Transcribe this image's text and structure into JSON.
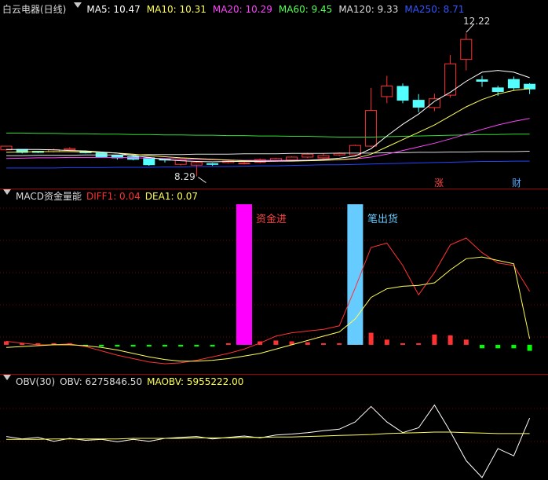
{
  "main": {
    "title": "白云电器(日线)",
    "indicators": [
      {
        "label": "MA5: 10.47",
        "color": "#ffffff"
      },
      {
        "label": "MA10: 10.31",
        "color": "#ffff55"
      },
      {
        "label": "MA20: 10.29",
        "color": "#ff44ff"
      },
      {
        "label": "MA60: 9.45",
        "color": "#55ff55"
      },
      {
        "label": "MA120: 9.33",
        "color": "#dddddd"
      },
      {
        "label": "MA250: 8.71",
        "color": "#3355ff"
      }
    ],
    "high_label": "12.22",
    "low_label": "8.29",
    "zhang_label": "涨",
    "cai_label": "财"
  },
  "macd": {
    "title": "MACD资金量能",
    "diff_label": "DIFF1: 0.04",
    "dea_label": "DEA1: 0.07",
    "in_label": "资金进",
    "out_label": "笔出货"
  },
  "obv": {
    "title": "OBV(30)",
    "obv_label": "OBV: 6275846.50",
    "maobv_label": "MAOBV: 5955222.00"
  },
  "colors": {
    "up": "#ff3232",
    "down": "#54ffff",
    "frame": "#a00000",
    "grid": "#7a0000",
    "in_bar": "#ff00ff",
    "out_bar": "#66ccff",
    "neg_hist": "#00ff00"
  },
  "chart_data": [
    {
      "type": "candlestick",
      "title": "白云电器(日线)",
      "x": [
        1,
        2,
        3,
        4,
        5,
        6,
        7,
        8,
        9,
        10,
        11,
        12,
        13,
        14,
        15,
        16,
        17,
        18,
        19,
        20,
        21,
        22,
        23,
        24,
        25,
        26,
        27,
        28,
        29,
        30,
        31,
        32,
        33,
        34
      ],
      "open": [
        9.02,
        9.03,
        8.98,
        8.97,
        9.02,
        8.98,
        8.93,
        8.87,
        8.83,
        8.8,
        8.76,
        8.62,
        8.6,
        8.64,
        8.67,
        8.66,
        8.68,
        8.72,
        8.74,
        8.82,
        8.8,
        8.88,
        8.88,
        9.12,
        10.48,
        10.76,
        10.38,
        10.18,
        10.52,
        11.5,
        10.94,
        10.72,
        10.95,
        10.82
      ],
      "close": [
        9.12,
        8.95,
        8.95,
        9.02,
        9.05,
        8.94,
        8.83,
        8.8,
        8.76,
        8.61,
        8.74,
        8.73,
        8.67,
        8.62,
        8.71,
        8.66,
        8.75,
        8.78,
        8.82,
        8.9,
        8.86,
        8.92,
        9.14,
        10.1,
        10.77,
        10.38,
        10.19,
        10.42,
        11.38,
        12.05,
        10.9,
        10.62,
        10.72,
        10.69
      ],
      "high": [
        9.12,
        9.04,
        8.98,
        9.05,
        9.09,
        9.0,
        8.94,
        8.88,
        8.85,
        8.82,
        8.77,
        8.75,
        8.7,
        8.66,
        8.73,
        8.7,
        8.78,
        8.8,
        8.84,
        8.94,
        8.92,
        8.95,
        9.16,
        10.72,
        11.05,
        10.84,
        10.55,
        10.56,
        11.62,
        12.22,
        11.05,
        10.78,
        11.03,
        10.85
      ],
      "low": [
        9.0,
        8.92,
        8.93,
        8.95,
        9.0,
        8.92,
        8.8,
        8.75,
        8.73,
        8.58,
        8.67,
        8.59,
        8.29,
        8.58,
        8.64,
        8.62,
        8.65,
        8.7,
        8.71,
        8.79,
        8.78,
        8.85,
        8.85,
        9.1,
        10.3,
        10.3,
        10.05,
        10.08,
        10.45,
        11.2,
        10.75,
        10.5,
        10.65,
        10.55
      ],
      "ma5": [
        9.03,
        9.03,
        9.03,
        9.02,
        9.0,
        8.99,
        8.96,
        8.93,
        8.86,
        8.81,
        8.75,
        8.72,
        8.7,
        8.69,
        8.7,
        8.7,
        8.7,
        8.71,
        8.72,
        8.73,
        8.76,
        8.79,
        8.85,
        9.05,
        9.4,
        9.72,
        10.0,
        10.35,
        10.6,
        10.9,
        11.15,
        11.2,
        11.15,
        11.0
      ],
      "ma10": [
        8.95,
        8.96,
        8.97,
        8.97,
        8.97,
        8.96,
        8.95,
        8.93,
        8.9,
        8.86,
        8.83,
        8.8,
        8.78,
        8.76,
        8.74,
        8.72,
        8.71,
        8.71,
        8.71,
        8.72,
        8.73,
        8.75,
        8.78,
        8.9,
        9.1,
        9.3,
        9.5,
        9.7,
        9.95,
        10.2,
        10.4,
        10.55,
        10.65,
        10.7
      ],
      "ma20": [
        8.78,
        8.79,
        8.8,
        8.8,
        8.81,
        8.81,
        8.81,
        8.81,
        8.8,
        8.79,
        8.78,
        8.77,
        8.76,
        8.75,
        8.74,
        8.73,
        8.73,
        8.73,
        8.73,
        8.74,
        8.74,
        8.75,
        8.77,
        8.82,
        8.9,
        9.0,
        9.1,
        9.2,
        9.32,
        9.45,
        9.58,
        9.7,
        9.8,
        9.88
      ],
      "ma60": [
        9.48,
        9.48,
        9.47,
        9.47,
        9.46,
        9.46,
        9.45,
        9.45,
        9.44,
        9.44,
        9.43,
        9.43,
        9.42,
        9.42,
        9.41,
        9.41,
        9.4,
        9.4,
        9.39,
        9.39,
        9.38,
        9.37,
        9.37,
        9.37,
        9.38,
        9.39,
        9.4,
        9.41,
        9.42,
        9.43,
        9.44,
        9.44,
        9.45,
        9.45
      ],
      "ma120": [
        8.86,
        8.86,
        8.87,
        8.87,
        8.87,
        8.88,
        8.88,
        8.88,
        8.88,
        8.89,
        8.89,
        8.89,
        8.9,
        8.9,
        8.9,
        8.91,
        8.91,
        8.91,
        8.92,
        8.92,
        8.92,
        8.93,
        8.93,
        8.93,
        8.94,
        8.94,
        8.95,
        8.95,
        8.96,
        8.96,
        8.97,
        8.97,
        8.97,
        8.98
      ],
      "ma250": [
        8.52,
        8.52,
        8.52,
        8.52,
        8.53,
        8.53,
        8.53,
        8.54,
        8.54,
        8.54,
        8.55,
        8.55,
        8.56,
        8.56,
        8.56,
        8.57,
        8.58,
        8.58,
        8.59,
        8.6,
        8.61,
        8.61,
        8.62,
        8.63,
        8.64,
        8.65,
        8.66,
        8.67,
        8.68,
        8.69,
        8.7,
        8.7,
        8.71,
        8.71
      ],
      "ylim": [
        8.0,
        12.7
      ]
    },
    {
      "type": "line",
      "title": "MACD资金量能",
      "x": [
        1,
        2,
        3,
        4,
        5,
        6,
        7,
        8,
        9,
        10,
        11,
        12,
        13,
        14,
        15,
        16,
        17,
        18,
        19,
        20,
        21,
        22,
        23,
        24,
        25,
        26,
        27,
        28,
        29,
        30,
        31,
        32,
        33,
        34
      ],
      "series": [
        {
          "name": "DIFF1",
          "values": [
            0.04,
            0.02,
            0.0,
            0.0,
            0.01,
            -0.02,
            -0.07,
            -0.12,
            -0.16,
            -0.2,
            -0.22,
            -0.21,
            -0.18,
            -0.14,
            -0.1,
            -0.05,
            0.02,
            0.1,
            0.14,
            0.16,
            0.18,
            0.22,
            0.66,
            1.13,
            1.18,
            0.92,
            0.58,
            0.84,
            1.16,
            1.24,
            1.07,
            0.95,
            0.92,
            0.62
          ]
        },
        {
          "name": "DEA1",
          "values": [
            -0.03,
            -0.02,
            -0.01,
            0.0,
            0.0,
            -0.01,
            -0.03,
            -0.06,
            -0.1,
            -0.14,
            -0.17,
            -0.19,
            -0.19,
            -0.18,
            -0.16,
            -0.13,
            -0.1,
            -0.05,
            0.0,
            0.05,
            0.1,
            0.15,
            0.3,
            0.55,
            0.65,
            0.68,
            0.69,
            0.72,
            0.87,
            1.0,
            1.02,
            0.98,
            0.94,
            0.07
          ]
        }
      ],
      "histogram": [
        0.04,
        0.02,
        0.0,
        0.0,
        0.01,
        -0.02,
        -0.02,
        -0.02,
        -0.02,
        -0.02,
        -0.02,
        -0.02,
        -0.02,
        -0.02,
        0.0,
        0.02,
        0.04,
        0.05,
        0.04,
        0.03,
        0.0,
        0.0,
        0.11,
        0.14,
        0.06,
        0.0,
        0.01,
        0.12,
        0.11,
        0.06,
        -0.04,
        -0.04,
        -0.04,
        -0.07
      ],
      "ylim": [
        -0.32,
        1.65
      ]
    },
    {
      "type": "line",
      "title": "OBV(30)",
      "x": [
        1,
        2,
        3,
        4,
        5,
        6,
        7,
        8,
        9,
        10,
        11,
        12,
        13,
        14,
        15,
        16,
        17,
        18,
        19,
        20,
        21,
        22,
        23,
        24,
        25,
        26,
        27,
        28,
        29,
        30,
        31,
        32,
        33,
        34
      ],
      "series": [
        {
          "name": "OBV",
          "values": [
            5.9,
            5.85,
            5.88,
            5.8,
            5.86,
            5.82,
            5.84,
            5.79,
            5.84,
            5.8,
            5.86,
            5.88,
            5.9,
            5.85,
            5.88,
            5.91,
            5.87,
            5.93,
            5.95,
            5.98,
            6.02,
            6.05,
            6.2,
            6.52,
            6.2,
            5.98,
            6.08,
            6.55,
            6.0,
            5.4,
            5.05,
            5.65,
            5.5,
            6.28
          ]
        },
        {
          "name": "MAOBV",
          "values": [
            5.84,
            5.84,
            5.84,
            5.85,
            5.85,
            5.85,
            5.85,
            5.85,
            5.86,
            5.86,
            5.86,
            5.86,
            5.87,
            5.87,
            5.87,
            5.88,
            5.88,
            5.89,
            5.89,
            5.9,
            5.91,
            5.92,
            5.93,
            5.94,
            5.96,
            5.97,
            5.98,
            5.99,
            5.99,
            5.98,
            5.97,
            5.96,
            5.96,
            5.96
          ]
        }
      ],
      "ylim": [
        5.0,
        6.9
      ]
    }
  ]
}
